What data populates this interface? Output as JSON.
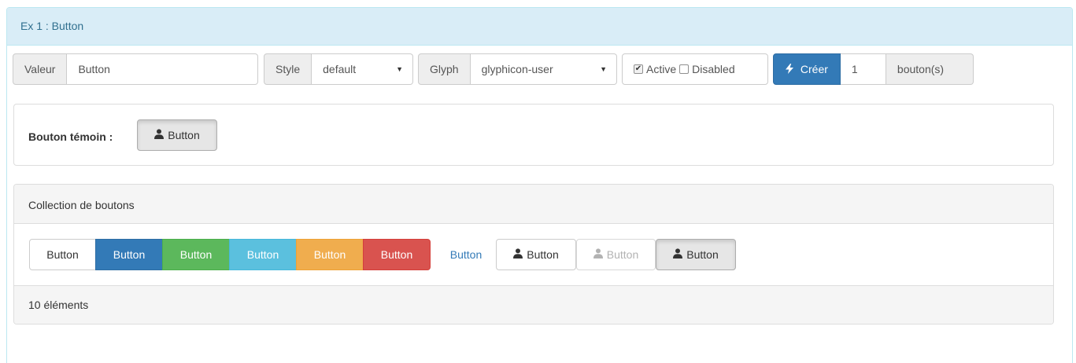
{
  "panel": {
    "title": "Ex 1 : Button"
  },
  "toolbar": {
    "valeur_label": "Valeur",
    "valeur_value": "Button",
    "style_label": "Style",
    "style_value": "default",
    "glyph_label": "Glyph",
    "glyph_value": "glyphicon-user",
    "active_label": "Active",
    "active_checked": true,
    "disabled_label": "Disabled",
    "disabled_checked": false,
    "create_label": "Créer",
    "count_value": "1",
    "count_suffix": "bouton(s)"
  },
  "temoin": {
    "label": "Bouton témoin :",
    "button_label": "Button"
  },
  "collection": {
    "title": "Collection de boutons",
    "buttons": [
      {
        "label": "Button",
        "variant": "default"
      },
      {
        "label": "Button",
        "variant": "primary"
      },
      {
        "label": "Button",
        "variant": "success"
      },
      {
        "label": "Button",
        "variant": "info"
      },
      {
        "label": "Button",
        "variant": "warning"
      },
      {
        "label": "Button",
        "variant": "danger"
      },
      {
        "label": "Button",
        "variant": "link"
      },
      {
        "label": "Button",
        "variant": "default",
        "icon": "user-icon"
      },
      {
        "label": "Button",
        "variant": "default",
        "icon": "user-icon",
        "state": "disabled"
      },
      {
        "label": "Button",
        "variant": "default",
        "icon": "user-icon",
        "state": "active"
      }
    ],
    "footer": "10 éléments"
  },
  "colors": {
    "heading_bg": "#d9edf7",
    "heading_text": "#31708f",
    "primary": "#337ab7",
    "success": "#5cb85c",
    "info": "#5bc0de",
    "warning": "#f0ad4e",
    "danger": "#d9534f"
  }
}
